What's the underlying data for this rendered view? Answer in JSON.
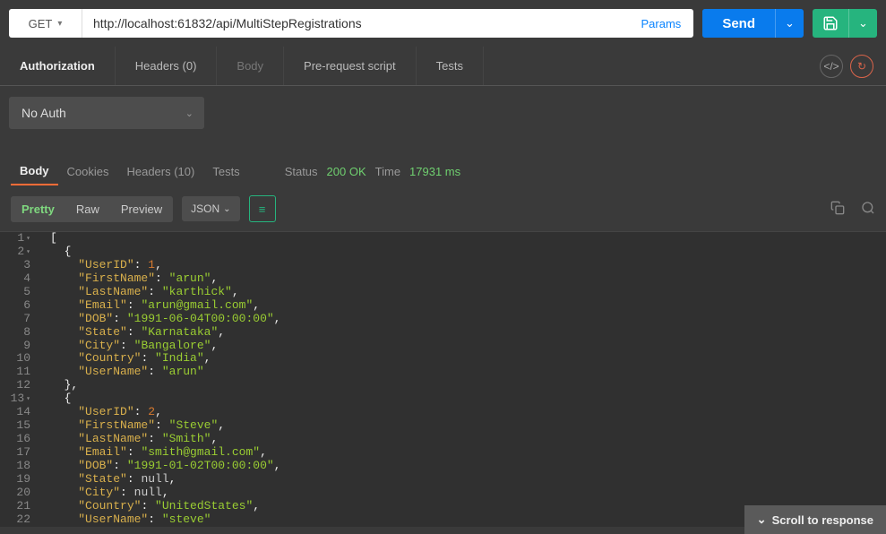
{
  "request": {
    "method": "GET",
    "url": "http://localhost:61832/api/MultiStepRegistrations",
    "params_label": "Params",
    "send_label": "Send"
  },
  "tabs": {
    "authorization": "Authorization",
    "headers": "Headers (0)",
    "body": "Body",
    "prereq": "Pre-request script",
    "tests": "Tests"
  },
  "auth_select": "No Auth",
  "response_tabs": {
    "body": "Body",
    "cookies": "Cookies",
    "headers": "Headers (10)",
    "tests": "Tests"
  },
  "status": {
    "status_label": "Status",
    "status_value": "200 OK",
    "time_label": "Time",
    "time_value": "17931 ms"
  },
  "view": {
    "pretty": "Pretty",
    "raw": "Raw",
    "preview": "Preview",
    "format": "JSON"
  },
  "scroll_label": "Scroll to response",
  "code": [
    {
      "n": 1,
      "fold": true,
      "indent": 0,
      "tokens": [
        {
          "t": "punc",
          "v": "["
        }
      ]
    },
    {
      "n": 2,
      "fold": true,
      "indent": 1,
      "tokens": [
        {
          "t": "punc",
          "v": "{"
        }
      ]
    },
    {
      "n": 3,
      "indent": 2,
      "tokens": [
        {
          "t": "key",
          "v": "\"UserID\""
        },
        {
          "t": "punc",
          "v": ": "
        },
        {
          "t": "num",
          "v": "1"
        },
        {
          "t": "punc",
          "v": ","
        }
      ]
    },
    {
      "n": 4,
      "indent": 2,
      "tokens": [
        {
          "t": "key",
          "v": "\"FirstName\""
        },
        {
          "t": "punc",
          "v": ": "
        },
        {
          "t": "str",
          "v": "\"arun\""
        },
        {
          "t": "punc",
          "v": ","
        }
      ]
    },
    {
      "n": 5,
      "indent": 2,
      "tokens": [
        {
          "t": "key",
          "v": "\"LastName\""
        },
        {
          "t": "punc",
          "v": ": "
        },
        {
          "t": "str",
          "v": "\"karthick\""
        },
        {
          "t": "punc",
          "v": ","
        }
      ]
    },
    {
      "n": 6,
      "indent": 2,
      "tokens": [
        {
          "t": "key",
          "v": "\"Email\""
        },
        {
          "t": "punc",
          "v": ": "
        },
        {
          "t": "str",
          "v": "\"arun@gmail.com\""
        },
        {
          "t": "punc",
          "v": ","
        }
      ]
    },
    {
      "n": 7,
      "indent": 2,
      "tokens": [
        {
          "t": "key",
          "v": "\"DOB\""
        },
        {
          "t": "punc",
          "v": ": "
        },
        {
          "t": "str",
          "v": "\"1991-06-04T00:00:00\""
        },
        {
          "t": "punc",
          "v": ","
        }
      ]
    },
    {
      "n": 8,
      "indent": 2,
      "tokens": [
        {
          "t": "key",
          "v": "\"State\""
        },
        {
          "t": "punc",
          "v": ": "
        },
        {
          "t": "str",
          "v": "\"Karnataka\""
        },
        {
          "t": "punc",
          "v": ","
        }
      ]
    },
    {
      "n": 9,
      "indent": 2,
      "tokens": [
        {
          "t": "key",
          "v": "\"City\""
        },
        {
          "t": "punc",
          "v": ": "
        },
        {
          "t": "str",
          "v": "\"Bangalore\""
        },
        {
          "t": "punc",
          "v": ","
        }
      ]
    },
    {
      "n": 10,
      "indent": 2,
      "tokens": [
        {
          "t": "key",
          "v": "\"Country\""
        },
        {
          "t": "punc",
          "v": ": "
        },
        {
          "t": "str",
          "v": "\"India\""
        },
        {
          "t": "punc",
          "v": ","
        }
      ]
    },
    {
      "n": 11,
      "indent": 2,
      "tokens": [
        {
          "t": "key",
          "v": "\"UserName\""
        },
        {
          "t": "punc",
          "v": ": "
        },
        {
          "t": "str",
          "v": "\"arun\""
        }
      ]
    },
    {
      "n": 12,
      "indent": 1,
      "tokens": [
        {
          "t": "punc",
          "v": "},"
        }
      ]
    },
    {
      "n": 13,
      "fold": true,
      "indent": 1,
      "tokens": [
        {
          "t": "punc",
          "v": "{"
        }
      ]
    },
    {
      "n": 14,
      "indent": 2,
      "tokens": [
        {
          "t": "key",
          "v": "\"UserID\""
        },
        {
          "t": "punc",
          "v": ": "
        },
        {
          "t": "num",
          "v": "2"
        },
        {
          "t": "punc",
          "v": ","
        }
      ]
    },
    {
      "n": 15,
      "indent": 2,
      "tokens": [
        {
          "t": "key",
          "v": "\"FirstName\""
        },
        {
          "t": "punc",
          "v": ": "
        },
        {
          "t": "str",
          "v": "\"Steve\""
        },
        {
          "t": "punc",
          "v": ","
        }
      ]
    },
    {
      "n": 16,
      "indent": 2,
      "tokens": [
        {
          "t": "key",
          "v": "\"LastName\""
        },
        {
          "t": "punc",
          "v": ": "
        },
        {
          "t": "str",
          "v": "\"Smith\""
        },
        {
          "t": "punc",
          "v": ","
        }
      ]
    },
    {
      "n": 17,
      "indent": 2,
      "tokens": [
        {
          "t": "key",
          "v": "\"Email\""
        },
        {
          "t": "punc",
          "v": ": "
        },
        {
          "t": "str",
          "v": "\"smith@gmail.com\""
        },
        {
          "t": "punc",
          "v": ","
        }
      ]
    },
    {
      "n": 18,
      "indent": 2,
      "tokens": [
        {
          "t": "key",
          "v": "\"DOB\""
        },
        {
          "t": "punc",
          "v": ": "
        },
        {
          "t": "str",
          "v": "\"1991-01-02T00:00:00\""
        },
        {
          "t": "punc",
          "v": ","
        }
      ]
    },
    {
      "n": 19,
      "indent": 2,
      "tokens": [
        {
          "t": "key",
          "v": "\"State\""
        },
        {
          "t": "punc",
          "v": ": "
        },
        {
          "t": "nul",
          "v": "null"
        },
        {
          "t": "punc",
          "v": ","
        }
      ]
    },
    {
      "n": 20,
      "indent": 2,
      "tokens": [
        {
          "t": "key",
          "v": "\"City\""
        },
        {
          "t": "punc",
          "v": ": "
        },
        {
          "t": "nul",
          "v": "null"
        },
        {
          "t": "punc",
          "v": ","
        }
      ]
    },
    {
      "n": 21,
      "indent": 2,
      "tokens": [
        {
          "t": "key",
          "v": "\"Country\""
        },
        {
          "t": "punc",
          "v": ": "
        },
        {
          "t": "str",
          "v": "\"UnitedStates\""
        },
        {
          "t": "punc",
          "v": ","
        }
      ]
    },
    {
      "n": 22,
      "indent": 2,
      "tokens": [
        {
          "t": "key",
          "v": "\"UserName\""
        },
        {
          "t": "punc",
          "v": ": "
        },
        {
          "t": "str",
          "v": "\"steve\""
        }
      ]
    }
  ]
}
